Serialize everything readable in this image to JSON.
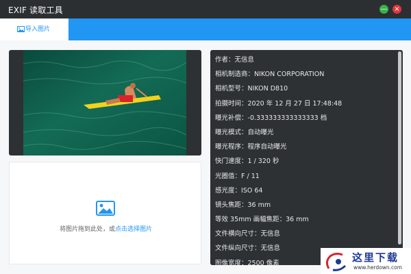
{
  "window": {
    "title": "EXIF 读取工具"
  },
  "toolbar": {
    "import_label": "导入图片"
  },
  "dropzone": {
    "hint_prefix": "将图片拖到此处，或",
    "hint_link": "点击选择图片"
  },
  "exif_rows": [
    {
      "label": "作者：",
      "value": "无信息"
    },
    {
      "label": "相机制造商：",
      "value": "NIKON CORPORATION"
    },
    {
      "label": "相机型号：",
      "value": "NIKON D810"
    },
    {
      "label": "拍摄时间：",
      "value": "2020 年 12 月 27 日 17:48:48"
    },
    {
      "label": "曝光补偿：",
      "value": "-0.333333333333333 档"
    },
    {
      "label": "曝光模式：",
      "value": "自动曝光"
    },
    {
      "label": "曝光程序：",
      "value": "程序自动曝光"
    },
    {
      "label": "快门速度：",
      "value": "1 / 320 秒"
    },
    {
      "label": "光圈值：",
      "value": "F / 11"
    },
    {
      "label": "感光度：",
      "value": "ISO 64"
    },
    {
      "label": "镜头焦距：",
      "value": "36 mm"
    },
    {
      "label": "等效 35mm 画幅焦距：",
      "value": "36 mm"
    },
    {
      "label": "文件横向尺寸：",
      "value": "无信息"
    },
    {
      "label": "文件纵向尺寸：",
      "value": "无信息"
    },
    {
      "label": "图像宽度：",
      "value": "2500 像素"
    }
  ],
  "watermark": {
    "text": "这里下载",
    "url": "www.herdown.com"
  },
  "colors": {
    "accent": "#2196f3",
    "titlebar": "#2b2f31",
    "panel": "#2d3134"
  }
}
